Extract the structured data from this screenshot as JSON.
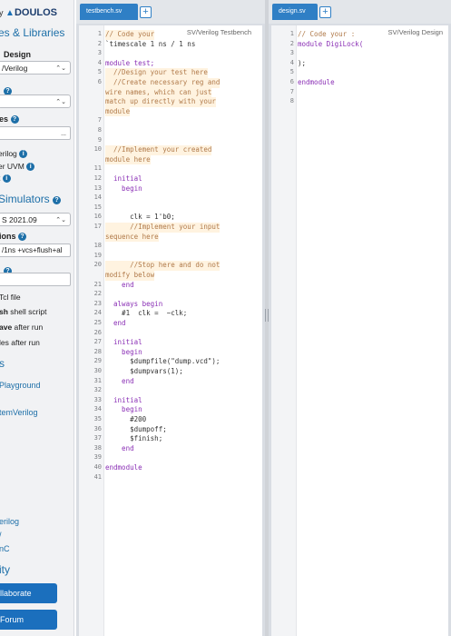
{
  "sidebar": {
    "logo_by": "by",
    "logo_name": "DOULOS",
    "languages_heading": "es & Libraries",
    "design_label": "Design",
    "design_select": "/Verilog",
    "select2_value": "",
    "libraries_label": "es",
    "libraries_field": "...",
    "opt_verilog": "erilog",
    "opt_uvm": "er UVM",
    "opt_t": "t",
    "simulators_heading": "Simulators",
    "simulator_select": "S 2021.09",
    "compile_options_label": "ions",
    "compile_options_value": "/1ns +vcs+flush+al",
    "run_options_value": "",
    "tcl_file": "Tcl file",
    "shell_script_bold": "sh",
    "shell_script_rest": " shell script",
    "after_run_bold": "ave",
    "after_run_rest": " after run",
    "files_after_run": "les after run",
    "examples_heading": "s",
    "link_playground": "Playground",
    "link_systemverilog": "temVerilog",
    "link_verilog": "erilog",
    "link_slash": "/",
    "link_nc": "nC",
    "community_heading": "ity",
    "collaborate_button": "llaborate",
    "forum_button": "Forum",
    "help_glyph": "?",
    "info_glyph": "i"
  },
  "left_pane": {
    "tab_label": "testbench.sv",
    "plus_label": "+",
    "editor_title": "SV/Verilog Testbench"
  },
  "right_pane": {
    "tab_label": "design.sv",
    "plus_label": "+",
    "editor_title": "SV/Verilog Design"
  },
  "testbench_lines": [
    {
      "n": "1",
      "t": "// Code your"
    },
    {
      "n": "2",
      "t": "`timescale 1 ns / 1 ns"
    },
    {
      "n": "3",
      "t": ""
    },
    {
      "n": "4",
      "t": "module test;"
    },
    {
      "n": "5",
      "t": "  //Design your test here"
    },
    {
      "n": "6",
      "t": "  //Create necessary reg and"
    },
    {
      "n": "",
      "t": "wire names, which can just"
    },
    {
      "n": "",
      "t": "match up directly with your"
    },
    {
      "n": "",
      "t": "module"
    },
    {
      "n": "7",
      "t": ""
    },
    {
      "n": "8",
      "t": ""
    },
    {
      "n": "9",
      "t": ""
    },
    {
      "n": "10",
      "t": "  //Implement your created"
    },
    {
      "n": "",
      "t": "module here"
    },
    {
      "n": "11",
      "t": ""
    },
    {
      "n": "12",
      "t": "  initial"
    },
    {
      "n": "13",
      "t": "    begin"
    },
    {
      "n": "14",
      "t": ""
    },
    {
      "n": "15",
      "t": ""
    },
    {
      "n": "16",
      "t": "      clk = 1'b0;"
    },
    {
      "n": "17",
      "t": "      //Implement your input"
    },
    {
      "n": "",
      "t": "sequence here"
    },
    {
      "n": "18",
      "t": ""
    },
    {
      "n": "19",
      "t": ""
    },
    {
      "n": "20",
      "t": "      //Stop here and do not"
    },
    {
      "n": "",
      "t": "modify below"
    },
    {
      "n": "21",
      "t": "    end"
    },
    {
      "n": "22",
      "t": ""
    },
    {
      "n": "23",
      "t": "  always begin"
    },
    {
      "n": "24",
      "t": "    #1  clk =  ~clk;"
    },
    {
      "n": "25",
      "t": "  end"
    },
    {
      "n": "26",
      "t": ""
    },
    {
      "n": "27",
      "t": "  initial"
    },
    {
      "n": "28",
      "t": "    begin"
    },
    {
      "n": "29",
      "t": "      $dumpfile(\"dump.vcd\");"
    },
    {
      "n": "30",
      "t": "      $dumpvars(1);"
    },
    {
      "n": "31",
      "t": "    end"
    },
    {
      "n": "32",
      "t": ""
    },
    {
      "n": "33",
      "t": "  initial"
    },
    {
      "n": "34",
      "t": "    begin"
    },
    {
      "n": "35",
      "t": "      #200"
    },
    {
      "n": "36",
      "t": "      $dumpoff;"
    },
    {
      "n": "37",
      "t": "      $finish;"
    },
    {
      "n": "38",
      "t": "    end"
    },
    {
      "n": "39",
      "t": ""
    },
    {
      "n": "40",
      "t": "endmodule"
    },
    {
      "n": "41",
      "t": ""
    }
  ],
  "design_lines": [
    {
      "n": "1",
      "t": "// Code your :"
    },
    {
      "n": "2",
      "t": "module DigiLock("
    },
    {
      "n": "3",
      "t": ""
    },
    {
      "n": "4",
      "t": ");"
    },
    {
      "n": "5",
      "t": ""
    },
    {
      "n": "6",
      "t": "endmodule"
    },
    {
      "n": "7",
      "t": ""
    },
    {
      "n": "8",
      "t": ""
    }
  ]
}
